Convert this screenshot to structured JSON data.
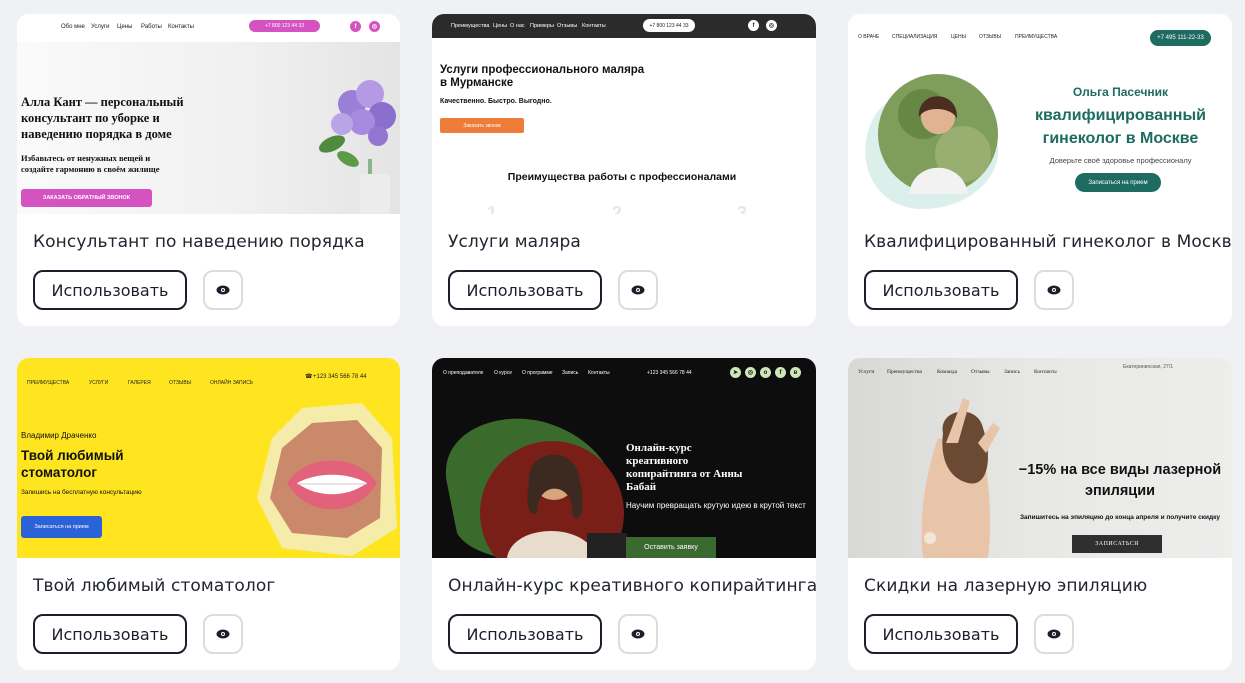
{
  "common": {
    "use_label": "Использовать"
  },
  "cards": [
    {
      "title": "Консультант по наведению порядка",
      "nav": [
        "Обо мне",
        "Услуги",
        "Цены",
        "Работы",
        "Контакты"
      ],
      "phone": "+7 800 123 44 33",
      "heading": "Алла Кант — персональный консультант по уборке и наведению порядка в доме",
      "subheading": "Избавьтесь от ненужных вещей и создайте гармонию в своём жилище",
      "cta": "ЗАКАЗАТЬ ОБРАТНЫЙ ЗВОНОК",
      "accent": "#d453c0"
    },
    {
      "title": "Услуги маляра",
      "nav": [
        "Преимущества",
        "Цены",
        "О нас",
        "Примеры",
        "Отзывы",
        "Контакты"
      ],
      "phone": "+7 800 123 44 33",
      "heading": "Услуги профессионального маляра в Мурманске",
      "subheading": "Качественно. Быстро. Выгодно.",
      "cta": "Заказать звонок",
      "section": "Преимущества работы с профессионалами",
      "accent": "#ef7d3a"
    },
    {
      "title": "Квалифицированный гинеколог в Москве",
      "nav": [
        "О ВРАЧЕ",
        "СПЕЦИАЛИЗАЦИЯ",
        "ЦЕНЫ",
        "ОТЗЫВЫ",
        "ПРЕИМУЩЕСТВА"
      ],
      "phone": "+7 495 111-22-33",
      "name": "Ольга Пасечник",
      "heading": "квалифицированный гинеколог в Москве",
      "subheading": "Доверьте своё здоровье профессионалу",
      "cta": "Записаться на прием",
      "accent": "#1e6b61"
    },
    {
      "title": "Твой любимый стоматолог",
      "nav": [
        "ПРЕИМУЩЕСТВА",
        "УСЛУГИ",
        "ГАЛЕРЕЯ",
        "ОТЗЫВЫ",
        "ОНЛАЙН ЗАПИСЬ"
      ],
      "phone": "+123 345 566 78 44",
      "name": "Владимир Драченко",
      "heading": "Твой любимый стоматолог",
      "subheading": "Запишись на бесплатную консультацию",
      "cta": "Записаться на прием",
      "accent": "#2b62d8"
    },
    {
      "title": "Онлайн-курс креативного копирайтинга",
      "nav": [
        "О преподавателе",
        "О курсе",
        "О программе",
        "Запись",
        "Контакты"
      ],
      "phone": "+123 345 566 78 44",
      "heading": "Онлайн-курс креативного копирайтинга от Анны Бабай",
      "subheading": "Научим превращать крутую идею в крутой текст",
      "cta": "Оставить заявку",
      "accent": "#3a6a30"
    },
    {
      "title": "Скидки на лазерную эпиляцию",
      "nav": [
        "Услуги",
        "Преимущества",
        "Команда",
        "Отзывы",
        "Запись",
        "Контакты"
      ],
      "address": "Екатерининская, 27/1",
      "heading": "−15% на все виды лазерной эпиляции",
      "subheading": "Запишитесь на эпиляцию до конца апреля и получите скидку",
      "cta": "ЗАПИСАТЬСЯ",
      "accent": "#2f2f2f"
    }
  ]
}
